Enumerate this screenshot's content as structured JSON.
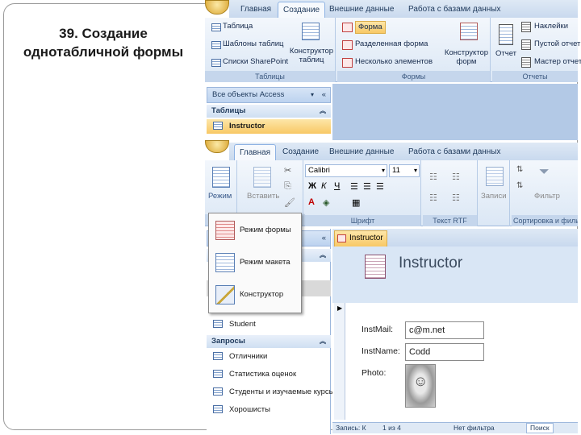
{
  "slide": {
    "title": "39. Создание однотабличной формы"
  },
  "top_window": {
    "tabs": [
      "Главная",
      "Создание",
      "Внешние данные",
      "Работа с базами данных"
    ],
    "active_tab": "Создание",
    "groups": {
      "tables": {
        "label": "Таблицы",
        "items": [
          "Таблица",
          "Шаблоны таблиц",
          "Списки SharePoint"
        ],
        "big_button": "Конструктор таблиц"
      },
      "forms": {
        "label": "Формы",
        "items": [
          "Форма",
          "Разделенная форма",
          "Несколько элементов"
        ],
        "big_button": "Конструктор форм"
      },
      "reports": {
        "label": "Отчеты",
        "big_button": "Отчет",
        "items": [
          "Наклейки",
          "Пустой отчет",
          "Мастер отчет"
        ]
      }
    },
    "nav": {
      "header": "Все объекты Access",
      "section": "Таблицы",
      "items": [
        "Instructor"
      ]
    }
  },
  "bottom_window": {
    "tabs": [
      "Главная",
      "Создание",
      "Внешние данные",
      "Работа с базами данных"
    ],
    "active_tab": "Главная",
    "groups": {
      "views": {
        "label": "Режим"
      },
      "clipboard": {
        "label": "Вставить"
      },
      "font": {
        "label": "Шрифт",
        "font_name": "Calibri",
        "font_size": "11"
      },
      "rich_text": {
        "label": "Текст RTF"
      },
      "records": {
        "label": "Записи"
      },
      "sort_filter": {
        "label": "Сортировка и филь",
        "filter_label": "Фильтр"
      }
    },
    "context_menu": {
      "items": [
        "Режим формы",
        "Режим макета",
        "Конструктор"
      ]
    },
    "nav": {
      "table_item": "Student",
      "queries_section": "Запросы",
      "query_items": [
        "Отличники",
        "Статистика оценок",
        "Студенты и изучаемые курсы",
        "Хорошисты"
      ]
    },
    "document": {
      "tab_label": "Instructor",
      "form_title": "Instructor",
      "fields": [
        {
          "label": "InstMail:",
          "value": "c@m.net"
        },
        {
          "label": "InstName:",
          "value": "Codd"
        },
        {
          "label": "Photo:",
          "value": ""
        }
      ],
      "status_left": "Запись: К",
      "status_pos": "1 из 4",
      "status_filter": "Нет фильтра",
      "status_search": "Поиск"
    }
  }
}
